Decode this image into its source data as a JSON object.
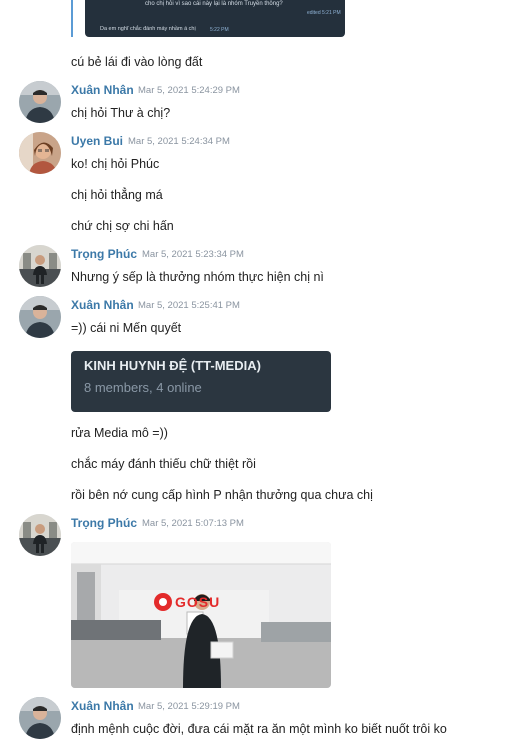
{
  "top_reply": {
    "preview_line1": "cho chị hỏi vì sao cái này lại là nhóm Truyền thông?",
    "preview_meta": "edited 5:21 PM",
    "preview_line2": "Da em nghĩ chắc đánh máy nhầm á chị",
    "preview_time2": "5:22 PM"
  },
  "messages": [
    {
      "text": "cú bẻ lái đi vào lòng đất"
    },
    {
      "author": "Xuân Nhân",
      "time": "Mar 5, 2021 5:24:29 PM",
      "text": "chị hỏi Thư à chị?"
    },
    {
      "author": "Uyen Bui",
      "time": "Mar 5, 2021 5:24:34 PM",
      "text": "ko! chị hỏi Phúc"
    },
    {
      "text": "chị hỏi thẳng má"
    },
    {
      "text": "chứ chị sợ chi hấn"
    },
    {
      "author": "Trọng Phúc",
      "time": "Mar 5, 2021 5:23:34 PM",
      "text": "Nhưng ý sếp là thưởng nhóm thực hiện chị nì"
    },
    {
      "author": "Xuân Nhân",
      "time": "Mar 5, 2021 5:25:41 PM",
      "text": "=)) cái ni Mến quyết"
    },
    {
      "text": "rửa Media mô =))"
    },
    {
      "text": "chắc máy đánh thiếu chữ thiệt rồi"
    },
    {
      "text": "rồi bên nớ cung cấp hình P nhận thưởng qua chưa chị"
    },
    {
      "author": "Trọng Phúc",
      "time": "Mar 5, 2021 5:07:13 PM"
    },
    {
      "author": "Xuân Nhân",
      "time": "Mar 5, 2021 5:29:19 PM",
      "text": "định mệnh cuộc đời, đưa cái mặt ra ăn một mình ko biết nuốt trôi ko"
    }
  ],
  "group_card": {
    "title": "KINH HUYNH ĐỆ (TT-MEDIA)",
    "subtitle": "8 members, 4 online"
  },
  "photo": {
    "logo_text": "GOSU"
  }
}
